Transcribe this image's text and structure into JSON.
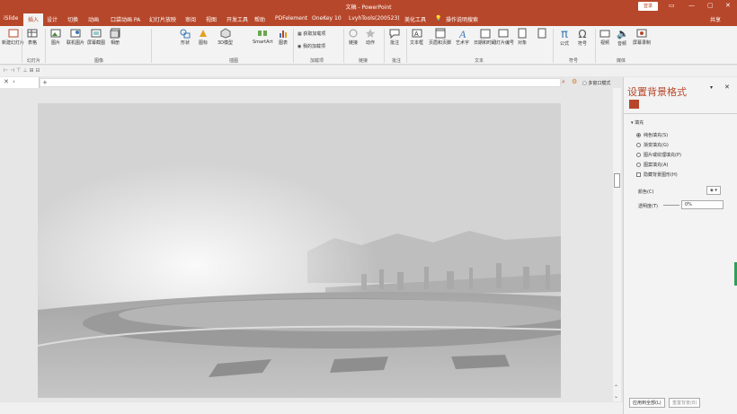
{
  "titlebar": {
    "doc": "文稿",
    "app": "PowerPoint",
    "signin": "登录"
  },
  "tabs": [
    "iSlide",
    "插入",
    "设计",
    "切换",
    "动画",
    "口袋动画 PA",
    "幻灯片放映",
    "审阅",
    "视图",
    "开发工具",
    "帮助",
    "PDFelement",
    "OneKey 10",
    "LvyhTools(200523)",
    "美化工具",
    "操作说明搜索",
    "共享"
  ],
  "ribbon": {
    "items": [
      "新建幻灯片",
      "表格",
      "图片",
      "联机图片",
      "屏幕截图",
      "相册",
      "形状",
      "图标",
      "3D模型",
      "SmartArt",
      "图表",
      "获取加载项",
      "我的加载项",
      "链接",
      "动作",
      "批注",
      "文本框",
      "页眉和页脚",
      "艺术字",
      "日期和时间",
      "幻灯片编号",
      "对象",
      "公式",
      "符号",
      "视频",
      "音频",
      "屏幕录制"
    ],
    "groups": [
      "幻灯片",
      "表格",
      "图像",
      "插图",
      "加载项",
      "链接",
      "批注",
      "文本",
      "符号",
      "媒体"
    ]
  },
  "addr": {
    "search_label": "多窗口模式"
  },
  "panel": {
    "title": "设置背景格式",
    "section": "填充",
    "options": [
      "纯色填充(S)",
      "渐变填充(G)",
      "图片或纹理填充(P)",
      "图案填充(A)"
    ],
    "hide_bg": "隐藏背景图形(H)",
    "color_label": "颜色(C)",
    "transparency_label": "透明度(T)",
    "transparency_value": "0%",
    "apply_all": "应用到全部(L)",
    "reset": "重置背景(B)"
  },
  "colors": {
    "accent": "#b7472a"
  }
}
